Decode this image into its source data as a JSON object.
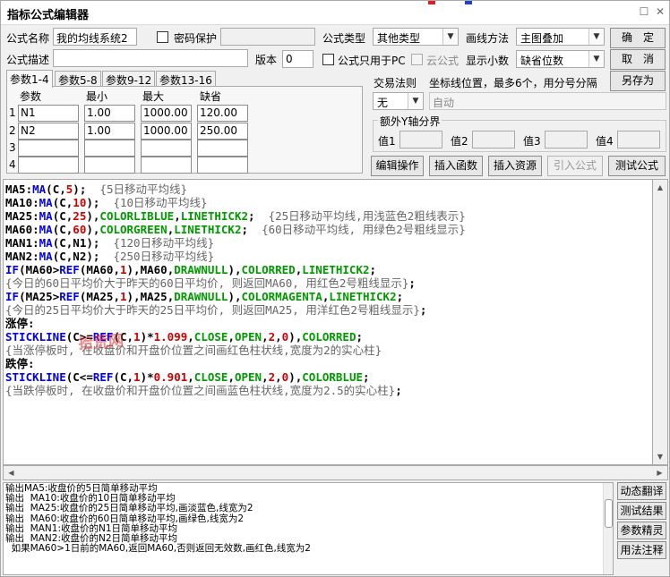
{
  "window": {
    "title": "指标公式编辑器",
    "close_icon": "✕",
    "restore_icon": "☐"
  },
  "header": {
    "name_label": "公式名称",
    "name_value": "我的均线系统2",
    "password_label": "密码保护",
    "type_label": "公式类型",
    "type_value": "其他类型",
    "draw_label": "画线方法",
    "draw_value": "主图叠加",
    "desc_label": "公式描述",
    "desc_value": "",
    "version_label": "版本",
    "version_value": "0",
    "pc_only_label": "公式只用于PC",
    "cloud_label": "云公式",
    "decimals_label": "显示小数",
    "decimals_value": "缺省位数"
  },
  "buttons": {
    "ok": "确　定",
    "cancel": "取　消",
    "save_as": "另存为",
    "edit_ops": "编辑操作",
    "insert_func": "插入函数",
    "insert_res": "插入资源",
    "import_formula": "引入公式",
    "test_formula": "测试公式"
  },
  "tabs": [
    "参数1-4",
    "参数5-8",
    "参数9-12",
    "参数13-16"
  ],
  "params": {
    "headers": [
      "参数",
      "最小",
      "最大",
      "缺省"
    ],
    "rows": [
      {
        "no": "1",
        "name": "N1",
        "min": "1.00",
        "max": "1000.00",
        "default": "120.00"
      },
      {
        "no": "2",
        "name": "N2",
        "min": "1.00",
        "max": "1000.00",
        "default": "250.00"
      },
      {
        "no": "3",
        "name": "",
        "min": "",
        "max": "",
        "default": ""
      },
      {
        "no": "4",
        "name": "",
        "min": "",
        "max": "",
        "default": ""
      }
    ]
  },
  "trade": {
    "rule_label": "交易法则",
    "coord_label": "坐标线位置，最多6个，用分号分隔",
    "rule_value": "无",
    "coord_value": "自动"
  },
  "yaxis": {
    "title": "额外Y轴分界",
    "labels": [
      "值1",
      "值2",
      "值3",
      "值4"
    ]
  },
  "editor": {
    "lines": [
      "MA5:MA(C,5);  {5日移动平均线}",
      "MA10:MA(C,10);  {10日移动平均线}",
      "MA25:MA(C,25),COLORLIBLUE,LINETHICK2;  {25日移动平均线,用浅蓝色2粗线表示}",
      "MA60:MA(C,60),COLORGREEN,LINETHICK2;  {60日移动平均线, 用绿色2号粗线显示}",
      "MAN1:MA(C,N1);  {120日移动平均线}",
      "MAN2:MA(C,N2);  {250日移动平均线}",
      "IF(MA60>REF(MA60,1),MA60,DRAWNULL),COLORRED,LINETHICK2;",
      "{今日的60日平均价大于昨天的60日平均价, 则返回MA60, 用红色2号粗线显示};",
      "IF(MA25>REF(MA25,1),MA25,DRAWNULL),COLORMAGENTA,LINETHICK2;",
      "{今日的25日平均价大于昨天的25日平均价, 则返回MA25, 用洋红色2号粗线显示};",
      "涨停:",
      "STICKLINE(C>=REF(C,1)*1.099,CLOSE,OPEN,2,0),COLORRED;",
      "{当涨停板时, 在收盘价和开盘价位置之间画红色柱状线,宽度为2的实心柱}",
      "跌停:",
      "STICKLINE(C<=REF(C,1)*0.901,CLOSE,OPEN,2,0),COLORBLUE;",
      "{当跌停板时, 在收盘价和开盘价位置之间画蓝色柱状线,宽度为2.5的实心柱};"
    ],
    "watermark": "拾荒网"
  },
  "output": {
    "lines": [
      "输出MA5:收盘价的5日简单移动平均",
      "输出  MA10:收盘价的10日简单移动平均",
      "输出  MA25:收盘价的25日简单移动平均,画淡蓝色,线宽为2",
      "输出  MA60:收盘价的60日简单移动平均,画绿色,线宽为2",
      "输出  MAN1:收盘价的N1日简单移动平均",
      "输出  MAN2:收盘价的N2日简单移动平均",
      "  如果MA60>1日前的MA60,返回MA60,否则返回无效数,画红色,线宽为2"
    ]
  },
  "side_buttons": [
    "动态翻译",
    "测试结果",
    "参数精灵",
    "用法注释"
  ],
  "colors": {
    "keyword": "#000000",
    "function": "#0000ee",
    "number": "#cc0000",
    "constant": "#009900",
    "comment": "#666666"
  }
}
